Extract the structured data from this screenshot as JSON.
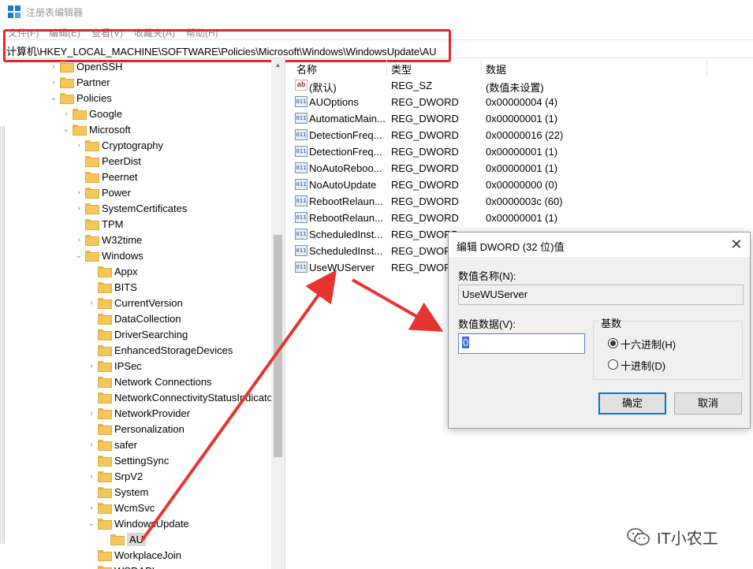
{
  "window": {
    "title": "注册表编辑器"
  },
  "menu": [
    "文件(F)",
    "编辑(E)",
    "查看(V)",
    "收藏夹(A)",
    "帮助(H)"
  ],
  "address": "计算机\\HKEY_LOCAL_MACHINE\\SOFTWARE\\Policies\\Microsoft\\Windows\\WindowsUpdate\\AU",
  "tree": [
    {
      "label": "OpenSSH",
      "arrow": "›"
    },
    {
      "label": "Partner",
      "arrow": "›"
    },
    {
      "label": "Policies",
      "arrow": "⌄"
    },
    {
      "label": "Google",
      "arrow": "›"
    },
    {
      "label": "Microsoft",
      "arrow": "⌄"
    },
    {
      "label": "Cryptography",
      "arrow": "›"
    },
    {
      "label": "PeerDist",
      "arrow": ""
    },
    {
      "label": "Peernet",
      "arrow": ""
    },
    {
      "label": "Power",
      "arrow": "›"
    },
    {
      "label": "SystemCertificates",
      "arrow": "›"
    },
    {
      "label": "TPM",
      "arrow": ""
    },
    {
      "label": "W32time",
      "arrow": "›"
    },
    {
      "label": "Windows",
      "arrow": "⌄"
    },
    {
      "label": "Appx",
      "arrow": ""
    },
    {
      "label": "BITS",
      "arrow": ""
    },
    {
      "label": "CurrentVersion",
      "arrow": "›"
    },
    {
      "label": "DataCollection",
      "arrow": ""
    },
    {
      "label": "DriverSearching",
      "arrow": ""
    },
    {
      "label": "EnhancedStorageDevices",
      "arrow": ""
    },
    {
      "label": "IPSec",
      "arrow": "›"
    },
    {
      "label": "Network Connections",
      "arrow": ""
    },
    {
      "label": "NetworkConnectivityStatusIndicator",
      "arrow": ""
    },
    {
      "label": "NetworkProvider",
      "arrow": "›"
    },
    {
      "label": "Personalization",
      "arrow": ""
    },
    {
      "label": "safer",
      "arrow": "›"
    },
    {
      "label": "SettingSync",
      "arrow": ""
    },
    {
      "label": "SrpV2",
      "arrow": "›"
    },
    {
      "label": "System",
      "arrow": ""
    },
    {
      "label": "WcmSvc",
      "arrow": "›"
    },
    {
      "label": "WindowsUpdate",
      "arrow": "⌄"
    },
    {
      "label": "AU",
      "arrow": ""
    },
    {
      "label": "WorkplaceJoin",
      "arrow": ""
    },
    {
      "label": "WSDAPI",
      "arrow": ""
    }
  ],
  "columns": {
    "name": "名称",
    "type": "类型",
    "data": "数据"
  },
  "values": [
    {
      "icon": "ab",
      "name": "(默认)",
      "type": "REG_SZ",
      "data": "(数值未设置)"
    },
    {
      "icon": "bin",
      "name": "AUOptions",
      "type": "REG_DWORD",
      "data": "0x00000004 (4)"
    },
    {
      "icon": "bin",
      "name": "AutomaticMain...",
      "type": "REG_DWORD",
      "data": "0x00000001 (1)"
    },
    {
      "icon": "bin",
      "name": "DetectionFreq...",
      "type": "REG_DWORD",
      "data": "0x00000016 (22)"
    },
    {
      "icon": "bin",
      "name": "DetectionFreq...",
      "type": "REG_DWORD",
      "data": "0x00000001 (1)"
    },
    {
      "icon": "bin",
      "name": "NoAutoReboo...",
      "type": "REG_DWORD",
      "data": "0x00000001 (1)"
    },
    {
      "icon": "bin",
      "name": "NoAutoUpdate",
      "type": "REG_DWORD",
      "data": "0x00000000 (0)"
    },
    {
      "icon": "bin",
      "name": "RebootRelaun...",
      "type": "REG_DWORD",
      "data": "0x0000003c (60)"
    },
    {
      "icon": "bin",
      "name": "RebootRelaun...",
      "type": "REG_DWORD",
      "data": "0x00000001 (1)"
    },
    {
      "icon": "bin",
      "name": "ScheduledInst...",
      "type": "REG_DWORD",
      "data": ""
    },
    {
      "icon": "bin",
      "name": "ScheduledInst...",
      "type": "REG_DWORD",
      "data": ""
    },
    {
      "icon": "bin",
      "name": "UseWUServer",
      "type": "REG_DWORD",
      "data": ""
    }
  ],
  "dialog": {
    "title": "编辑 DWORD (32 位)值",
    "name_label": "数值名称(N):",
    "name_value": "UseWUServer",
    "data_label": "数值数据(V):",
    "data_value": "0",
    "base_label": "基数",
    "radio_hex": "十六进制(H)",
    "radio_dec": "十进制(D)",
    "ok": "确定",
    "cancel": "取消"
  },
  "watermark": "IT小农工",
  "colors": {
    "highlight_red": "#e3262b",
    "arrow_red": "#e8342f",
    "accent": "#0078d7"
  }
}
